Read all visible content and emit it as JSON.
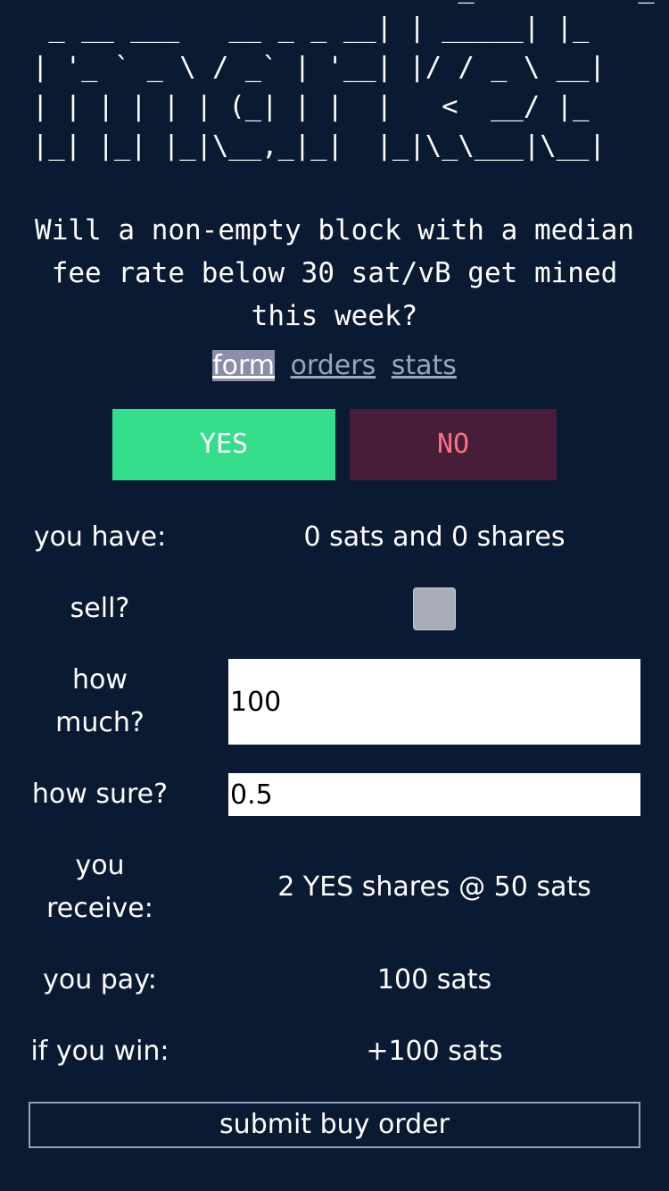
{
  "logo": {
    "ascii_art": "                          _          _\n _ __ ___   __ _ _ __| | _____| |_\n| '_ ` _ \\ / _` | '__| |/ / _ \\ __|\n| | | | | | (_| | |  |   <  __/ |_\n|_| |_| |_|\\__,_|_|  |_|\\_\\___|\\__|"
  },
  "market": {
    "question": "Will a non-empty block with a median fee rate below 30 sat/vB get mined this week?"
  },
  "tabs": [
    {
      "label": "form",
      "active": true
    },
    {
      "label": "orders",
      "active": false
    },
    {
      "label": "stats",
      "active": false
    }
  ],
  "outcome": {
    "yes_label": "YES",
    "no_label": "NO",
    "selected": "YES",
    "yes_color": "#35de8a",
    "no_color": "#461e3a",
    "no_text_color": "#ff6f7f"
  },
  "form": {
    "you_have_label": "you have:",
    "you_have_value": "0 sats and 0 shares",
    "sell_label": "sell?",
    "sell_checked": false,
    "how_much_label": "how much?",
    "how_much_value": "100",
    "how_sure_label": "how sure?",
    "how_sure_value": "0.5",
    "you_receive_label": "you receive:",
    "you_receive_value": "2 YES shares @ 50 sats",
    "you_pay_label": "you pay:",
    "you_pay_value": "100 sats",
    "if_you_win_label": "if you win:",
    "if_you_win_value": "+100 sats"
  },
  "submit": {
    "label": "submit buy order"
  },
  "theme": {
    "background": "#0b1a33",
    "text": "#ffffff",
    "link": "#9aa3bf"
  }
}
